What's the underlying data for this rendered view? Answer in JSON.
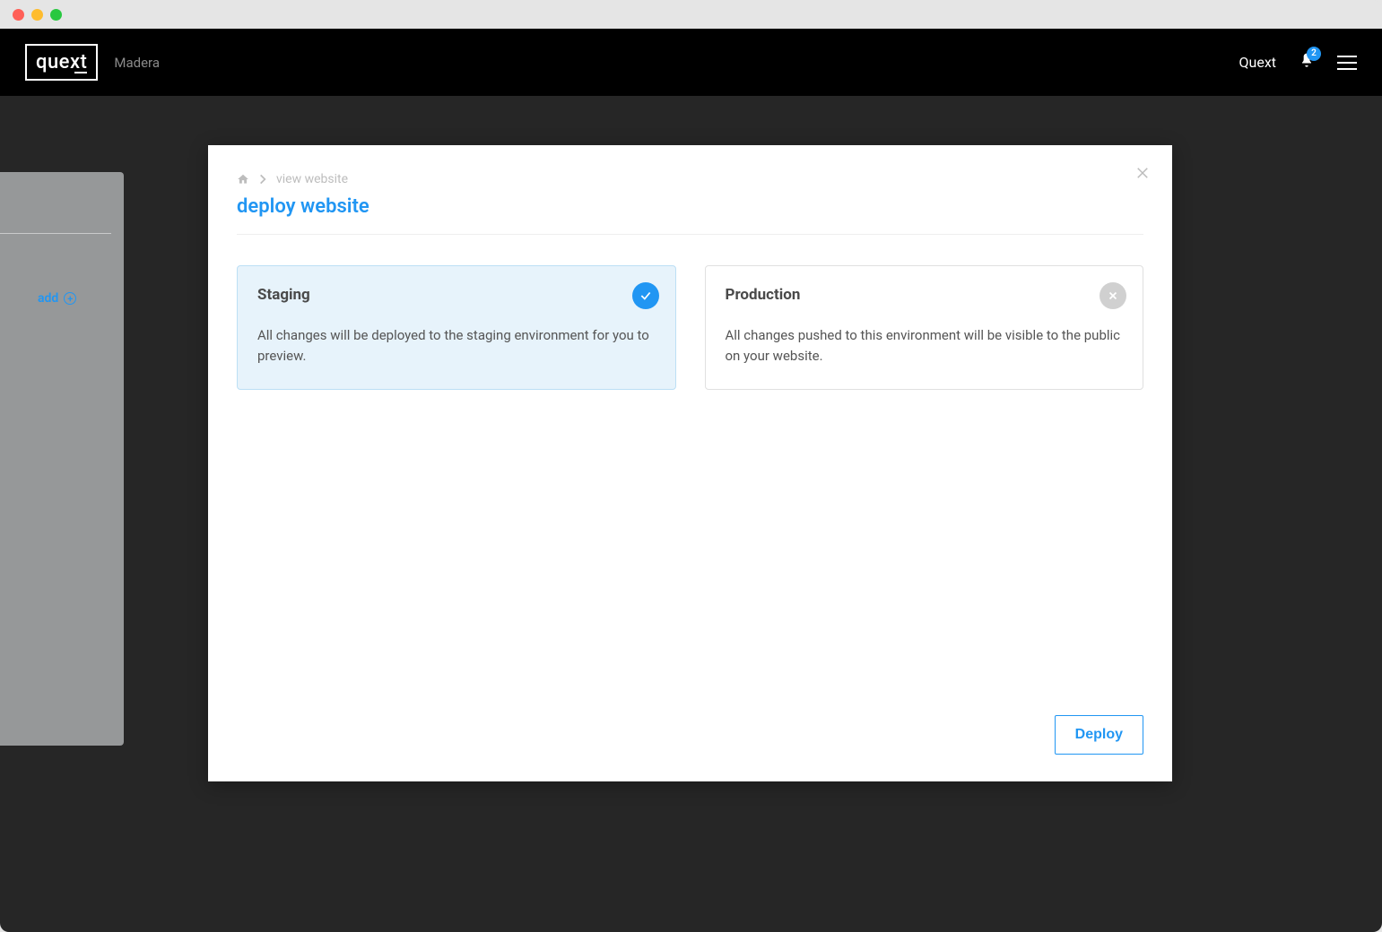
{
  "header": {
    "logo_text": "quext",
    "project_name": "Madera",
    "user_label": "Quext",
    "notification_count": "2"
  },
  "backdrop": {
    "add_label": "add"
  },
  "modal": {
    "breadcrumb_label": "view website",
    "title": "deploy website",
    "deploy_button": "Deploy",
    "cards": {
      "staging": {
        "title": "Staging",
        "description": "All changes will be deployed to the staging environment for you to preview."
      },
      "production": {
        "title": "Production",
        "description": "All changes pushed to this environment will be visible to the public on your website."
      }
    }
  }
}
